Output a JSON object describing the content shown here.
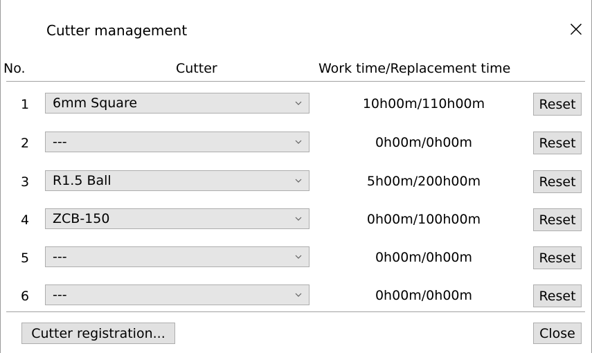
{
  "dialog": {
    "title": "Cutter management",
    "close_glyph": "×"
  },
  "table": {
    "headers": {
      "no": "No.",
      "cutter": "Cutter",
      "time": "Work time/Replacement time"
    },
    "rows": [
      {
        "no": "1",
        "cutter": "6mm Square",
        "time": "10h00m/110h00m",
        "reset_label": "Reset"
      },
      {
        "no": "2",
        "cutter": "---",
        "time": "0h00m/0h00m",
        "reset_label": "Reset"
      },
      {
        "no": "3",
        "cutter": "R1.5 Ball",
        "time": "5h00m/200h00m",
        "reset_label": "Reset"
      },
      {
        "no": "4",
        "cutter": "ZCB-150",
        "time": "0h00m/100h00m",
        "reset_label": "Reset"
      },
      {
        "no": "5",
        "cutter": "---",
        "time": "0h00m/0h00m",
        "reset_label": "Reset"
      },
      {
        "no": "6",
        "cutter": "---",
        "time": "0h00m/0h00m",
        "reset_label": "Reset"
      }
    ]
  },
  "footer": {
    "registration_label": "Cutter registration...",
    "close_label": "Close"
  },
  "icons": {
    "dropdown": "chevron-down-icon",
    "close": "close-icon"
  },
  "colors": {
    "combo_bg": "#e5e5e5",
    "button_bg": "#e1e1e1",
    "border": "#adadad",
    "separator": "#a0a0a0"
  }
}
